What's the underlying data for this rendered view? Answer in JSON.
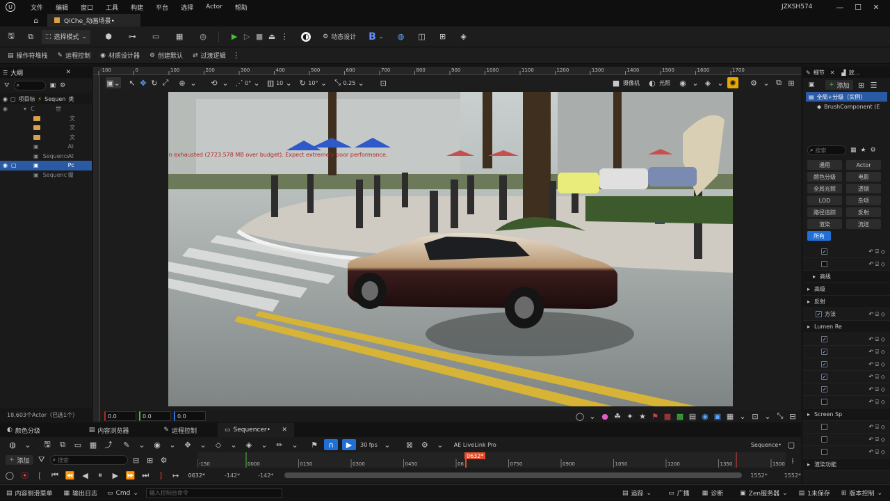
{
  "titlebar": {
    "menus": [
      "文件",
      "编辑",
      "窗口",
      "工具",
      "构建",
      "平台",
      "选择",
      "Actor",
      "帮助"
    ],
    "project": "JZKSH574"
  },
  "tab": {
    "title": "QiChe_动画场景•"
  },
  "toolbar": {
    "select_mode": "选择模式",
    "dynamic_design": "动态设计",
    "b_label": "B"
  },
  "toolbar2": {
    "items": [
      "操作符堆栈",
      "运程控制",
      "材质设计器",
      "创建默认",
      "过渡逻辑"
    ]
  },
  "outliner": {
    "title": "大纲",
    "col_label": "项目标",
    "col_type": "类",
    "seq_label": "Sequen",
    "rows": [
      {
        "label": "C",
        "type": "世",
        "indent": 34,
        "kind": "level"
      },
      {
        "label": "",
        "type": "文",
        "indent": 48,
        "kind": "folder"
      },
      {
        "label": "",
        "type": "文",
        "indent": 48,
        "kind": "folder"
      },
      {
        "label": "",
        "type": "文",
        "indent": 48,
        "kind": "folder"
      },
      {
        "label": "",
        "type": "At",
        "indent": 48,
        "kind": "actor"
      },
      {
        "label": "Sequence",
        "type": "At",
        "indent": 48,
        "kind": "actor"
      },
      {
        "label": "",
        "type": "Pc",
        "indent": 48,
        "kind": "actor",
        "selected": true
      },
      {
        "label": "Sequenc",
        "type": "撮",
        "indent": 48,
        "kind": "actor"
      }
    ],
    "status": "18,603个Actor（已选1个）"
  },
  "viewport": {
    "ruler": [
      "-100",
      "0",
      "100",
      "200",
      "300",
      "400",
      "500",
      "600",
      "700",
      "800",
      "900",
      "1000",
      "1100",
      "1200",
      "1300",
      "1400",
      "1500",
      "1600",
      "1700"
    ],
    "toolbar": {
      "rot": "0°",
      "snap": "10",
      "angle": "10°",
      "scale": "0.25",
      "camera": "摄像机",
      "lighting": "光照"
    },
    "warning": "Video memory has been exhausted (2723.578 MB over budget). Expect extremely poor performance.",
    "coords": [
      "0.0",
      "0.0",
      "0.0"
    ]
  },
  "details": {
    "tabs": [
      "细节",
      "放..."
    ],
    "add_label": "添加",
    "root": "全局+分级（实例）",
    "component": "BrushComponent (E",
    "search_placeholder": "搜索",
    "filters": [
      [
        "通用",
        "Actor"
      ],
      [
        "颜色分级",
        "电影"
      ],
      [
        "全局光照",
        "透镜"
      ],
      [
        "LOD",
        "杂项"
      ],
      [
        "路径追踪",
        "反射"
      ],
      [
        "渲染",
        "流送"
      ],
      [
        "所有",
        ""
      ]
    ],
    "sections": [
      "高级",
      "高级",
      "反射",
      "方法",
      "Lumen Re",
      "Screen Sp",
      "渲染功能"
    ]
  },
  "bottomtabs": [
    "颜色分级",
    "内容浏览器",
    "运程控制",
    "Sequencer•"
  ],
  "sequencer": {
    "add_label": "添加",
    "search_placeholder": "搜索",
    "fps": "30 fps",
    "livelink": "AE LiveLink Pro",
    "seq_name": "Sequence•",
    "playhead": "0632*",
    "ticks": [
      "-150",
      "0000",
      "0150",
      "0300",
      "0450",
      "06",
      "0750",
      "0900",
      "1050",
      "1200",
      "1350",
      "1500"
    ],
    "start": "-142*",
    "start2": "-142*",
    "end": "1552*",
    "end2": "1552*",
    "current": "0632*"
  },
  "statusbar": {
    "content_drawer": "内容侧滑菜单",
    "output_log": "输出日志",
    "cmd": "Cmd",
    "cmd_placeholder": "输入控制台命令",
    "trace": "追踪",
    "broadcast": "广播",
    "diagnose": "诊断",
    "zen": "Zen服务器",
    "unsaved": "1未保存",
    "version": "版本控制"
  },
  "colors": {
    "accent": "#1f6fd6",
    "active_icon": "#e8a800",
    "play": "#46c036",
    "warn": "#b32828",
    "playhead": "#e04a2a"
  }
}
